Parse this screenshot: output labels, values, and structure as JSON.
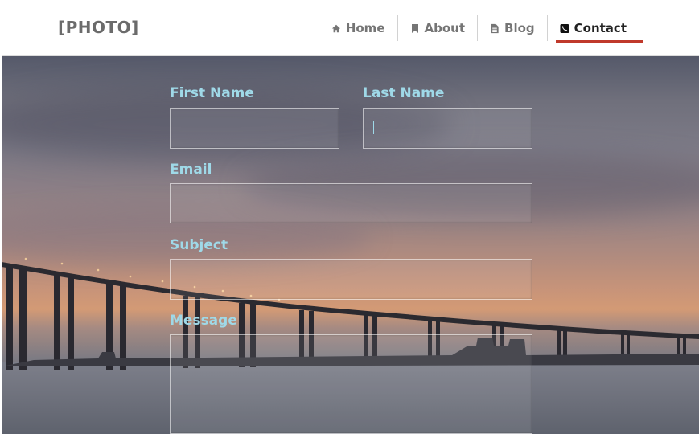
{
  "header": {
    "logo": "[PHOTO]",
    "nav": [
      {
        "label": "Home",
        "icon": "home-icon"
      },
      {
        "label": "About",
        "icon": "bookmark-icon"
      },
      {
        "label": "Blog",
        "icon": "document-icon"
      },
      {
        "label": "Contact",
        "icon": "phone-icon",
        "active": true
      }
    ]
  },
  "form": {
    "first_name_label": "First Name",
    "first_name_value": "",
    "last_name_label": "Last Name",
    "last_name_value": "",
    "email_label": "Email",
    "email_value": "",
    "subject_label": "Subject",
    "subject_value": "",
    "message_label": "Message",
    "message_value": ""
  },
  "colors": {
    "label": "#9fd9e8",
    "active_underline": "#c0392b",
    "nav_text": "#757575",
    "nav_active_text": "#222222"
  }
}
